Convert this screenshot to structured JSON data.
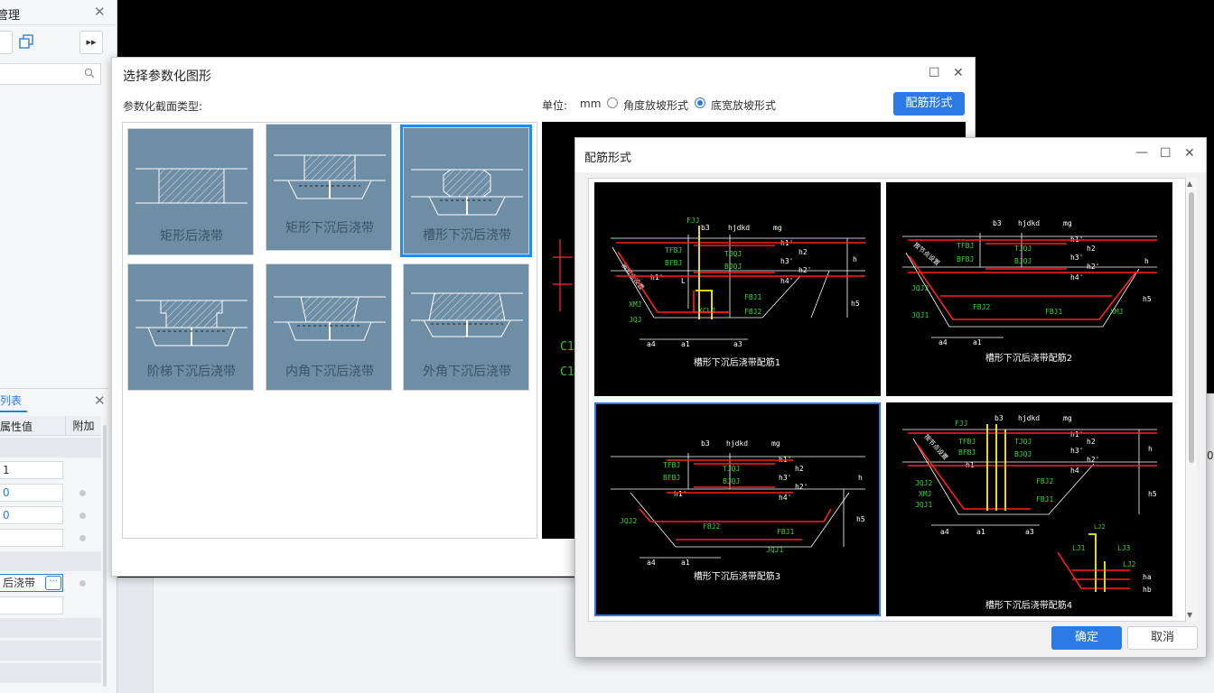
{
  "left_panel": {
    "title": "管理",
    "close": "✕",
    "more_btn": "▸▸",
    "properties": {
      "tab": "列表",
      "close": "✕",
      "col_value": "属性值",
      "col_extra": "附加",
      "rows": [
        {
          "value": "1",
          "blue": false
        },
        {
          "value": "0",
          "blue": true
        },
        {
          "value": "0",
          "blue": true
        },
        {
          "value": "",
          "blue": false
        },
        {
          "value": "后浇带",
          "blue": false
        },
        {
          "value": "",
          "blue": false
        }
      ],
      "more_label": "···"
    }
  },
  "right_edge_text": "0",
  "dialog1": {
    "title": "选择参数化图形",
    "maximize": "☐",
    "close": "✕",
    "section_label": "参数化截面类型:",
    "unit_label": "单位:",
    "unit_value": "mm",
    "radio_angle": "角度放坡形式",
    "radio_width": "底宽放坡形式",
    "selected_radio": "width",
    "rebar_button": "配筋形式",
    "tiles": [
      {
        "label": "矩形后浇带",
        "selected": false
      },
      {
        "label": "矩形下沉后浇带",
        "selected": false
      },
      {
        "label": "槽形下沉后浇带",
        "selected": true
      },
      {
        "label": "阶梯下沉后浇带",
        "selected": false
      },
      {
        "label": "内角下沉后浇带",
        "selected": false
      },
      {
        "label": "外角下沉后浇带",
        "selected": false
      }
    ],
    "preview_text": [
      "C1",
      "C1"
    ]
  },
  "dialog2": {
    "title": "配筋形式",
    "minimize": "—",
    "maximize": "☐",
    "close": "✕",
    "ok": "确定",
    "cancel": "取消",
    "options": [
      {
        "caption": "槽形下沉后浇带配筋1",
        "selected": false
      },
      {
        "caption": "槽形下沉后浇带配筋2",
        "selected": false
      },
      {
        "caption": "槽形下沉后浇带配筋3",
        "selected": true
      },
      {
        "caption": "槽形下沉后浇带配筋4",
        "selected": false
      }
    ],
    "cad_labels": {
      "fjj": "FJJ",
      "b3": "b3",
      "hjdkd": "hjdkd",
      "mg": "mg",
      "tfbj": "TFBJ",
      "bfbj": "BFBJ",
      "tjqj": "TJQJ",
      "bjqj": "BJQJ",
      "h": "h",
      "h1p": "h1'",
      "h2p": "h2'",
      "h3p": "h3'",
      "h4p": "h4'",
      "h1": "h1",
      "h2": "h2",
      "h4": "h4",
      "h5": "h5",
      "l": "L",
      "xmj": "XMJ",
      "jqj": "JQJ",
      "xclj": "XCLJ",
      "fbj1": "FBJ1",
      "fbj2": "FBJ2",
      "jqj1": "JQJ1",
      "jqj2": "JQJ2",
      "a1": "a1",
      "a3": "a3",
      "a4": "a4",
      "diag": "按节点设置",
      "lj1": "LJ1",
      "lj2": "LJ2",
      "lj3": "LJ3",
      "ha": "ha",
      "hb": "hb"
    }
  },
  "colors": {
    "accent": "#2c7be5",
    "tile_bg": "#6e8ea5",
    "cad_red": "#ff2020",
    "cad_green": "#30d530",
    "cad_yellow": "#ffee22"
  }
}
